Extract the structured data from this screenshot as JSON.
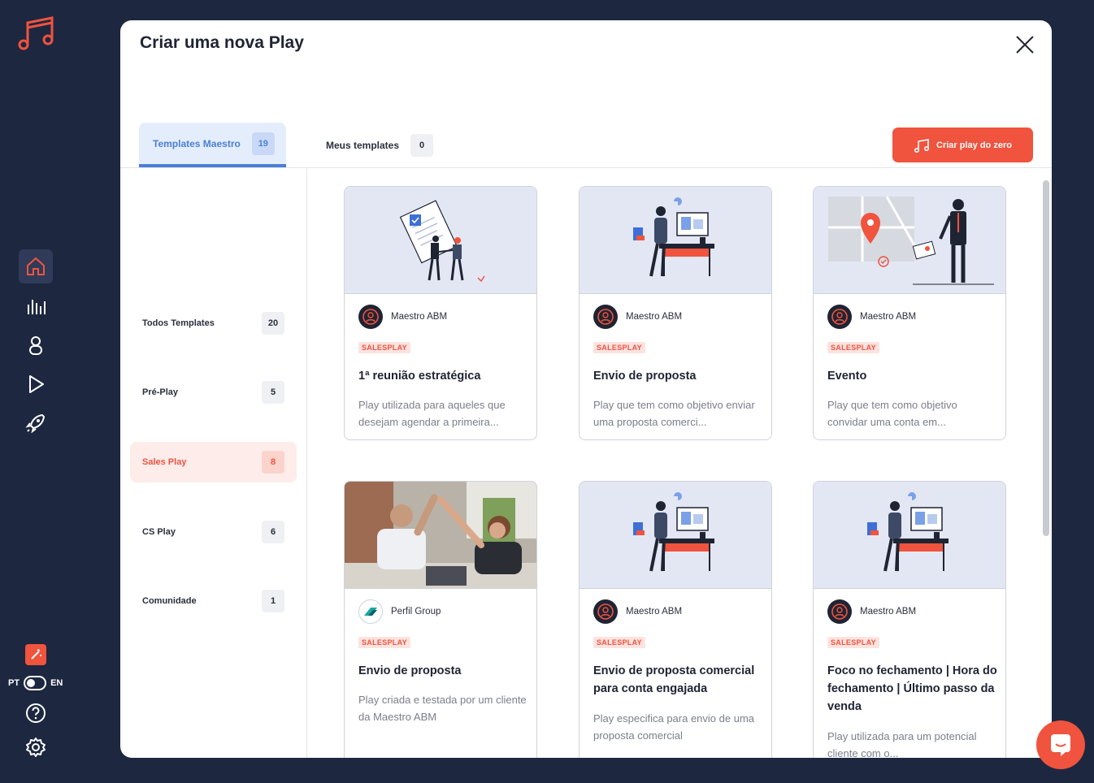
{
  "modal": {
    "title": "Criar uma nova Play"
  },
  "tabs": [
    {
      "label": "Templates Maestro",
      "count": "19"
    },
    {
      "label": "Meus templates",
      "count": "0"
    }
  ],
  "create_button": {
    "label": "Criar play do zero"
  },
  "categories": [
    {
      "label": "Todos Templates",
      "count": "20"
    },
    {
      "label": "Pré-Play",
      "count": "5"
    },
    {
      "label": "Sales Play",
      "count": "8"
    },
    {
      "label": "CS Play",
      "count": "6"
    },
    {
      "label": "Comunidade",
      "count": "1"
    }
  ],
  "language": {
    "left": "PT",
    "right": "EN"
  },
  "cards": [
    {
      "author": "Maestro ABM",
      "tag": "SALESPLAY",
      "title": "1ª reunião estratégica",
      "desc": "Play utilizada para aqueles que desejam agendar a primeira..."
    },
    {
      "author": "Maestro ABM",
      "tag": "SALESPLAY",
      "title": "Envio de proposta",
      "desc": "Play que tem como objetivo enviar uma proposta comerci..."
    },
    {
      "author": "Maestro ABM",
      "tag": "SALESPLAY",
      "title": "Evento",
      "desc": "Play que tem como objetivo convidar uma conta em..."
    },
    {
      "author": "Perfil Group",
      "tag": "SALESPLAY",
      "title": "Envio de proposta",
      "desc": "Play criada e testada por um cliente da Maestro ABM"
    },
    {
      "author": "Maestro ABM",
      "tag": "SALESPLAY",
      "title": "Envio de proposta comercial para conta engajada",
      "desc": "Play especifica para envio de uma proposta comercial"
    },
    {
      "author": "Maestro ABM",
      "tag": "SALESPLAY",
      "title": "Foco no fechamento | Hora do fechamento | Último passo da venda",
      "desc": "Play utilizada para um potencial cliente com o..."
    }
  ],
  "colors": {
    "accent": "#f0533e",
    "blue": "#4a7fd8",
    "rail": "#1d2740"
  }
}
